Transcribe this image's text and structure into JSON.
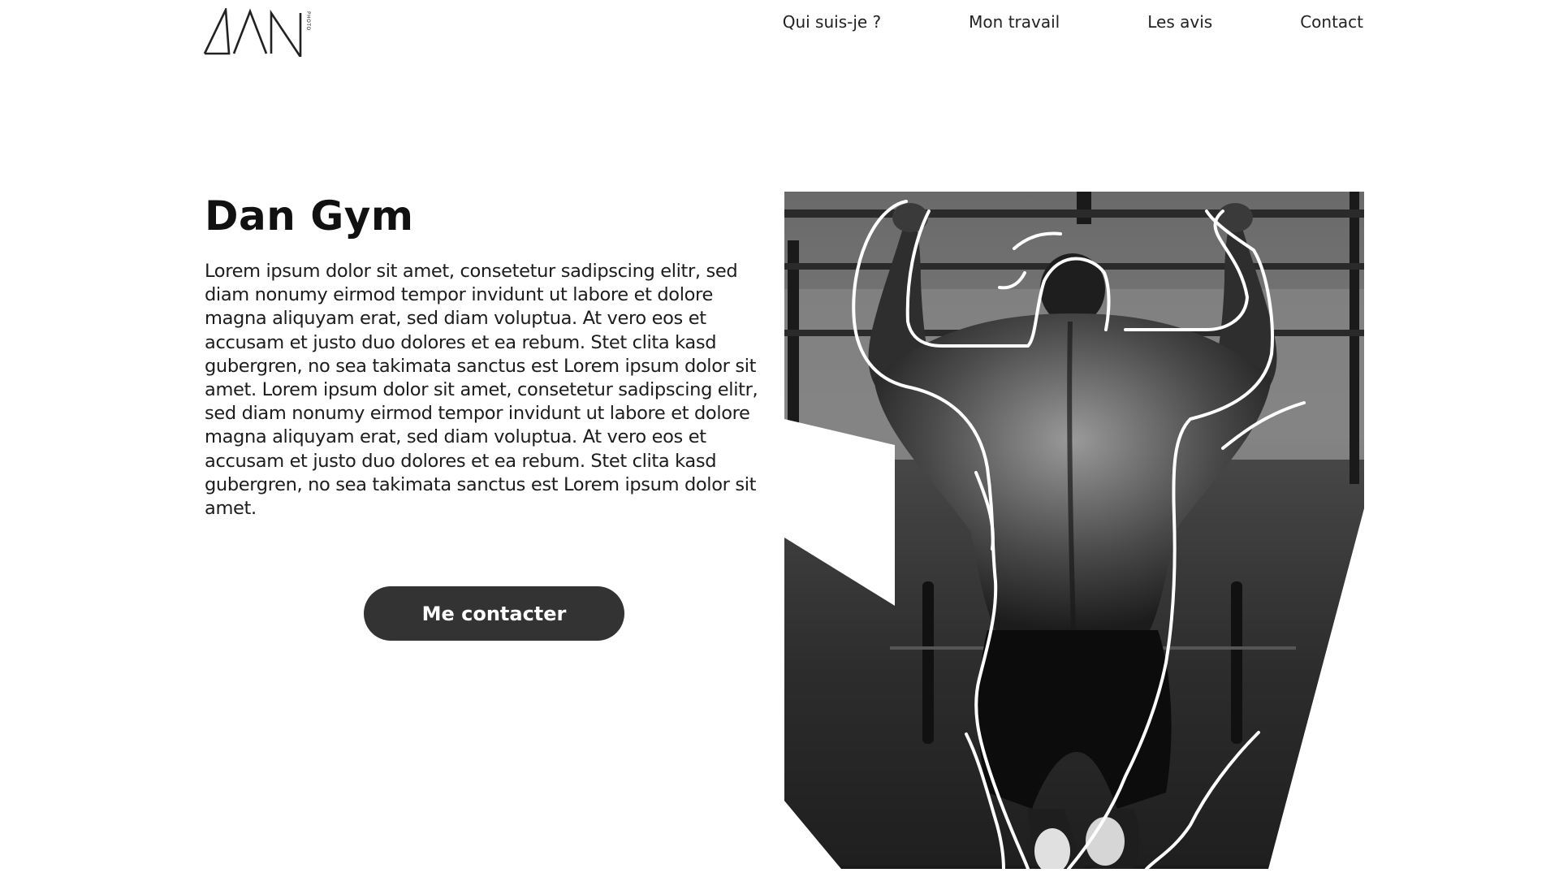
{
  "header": {
    "logo_text": "ΔΛΝ",
    "logo_sub": "PHOTO",
    "nav": [
      {
        "label": "Qui suis-je ?"
      },
      {
        "label": "Mon travail"
      },
      {
        "label": "Les avis"
      },
      {
        "label": "Contact"
      }
    ]
  },
  "hero": {
    "title": "Dan Gym",
    "body": "Lorem ipsum dolor sit amet, consetetur sadipscing elitr, sed diam nonumy eirmod tempor invidunt ut labore et dolore magna aliquyam erat, sed diam voluptua. At vero eos et accusam et justo duo dolores et ea rebum. Stet clita kasd gubergren, no sea takimata sanctus est Lorem ipsum dolor sit amet. Lorem ipsum dolor sit amet, consetetur sadipscing elitr, sed diam nonumy eirmod tempor invidunt ut labore et dolore magna aliquyam erat, sed diam voluptua. At vero eos et accusam et justo duo dolores et ea rebum. Stet clita kasd gubergren, no sea takimata sanctus est Lorem ipsum dolor sit amet.",
    "cta_label": "Me contacter"
  },
  "colors": {
    "button_bg": "#333333",
    "text": "#111111",
    "image_tone": "grayscale"
  },
  "icons": {
    "logo": "dan-photo-logo"
  }
}
